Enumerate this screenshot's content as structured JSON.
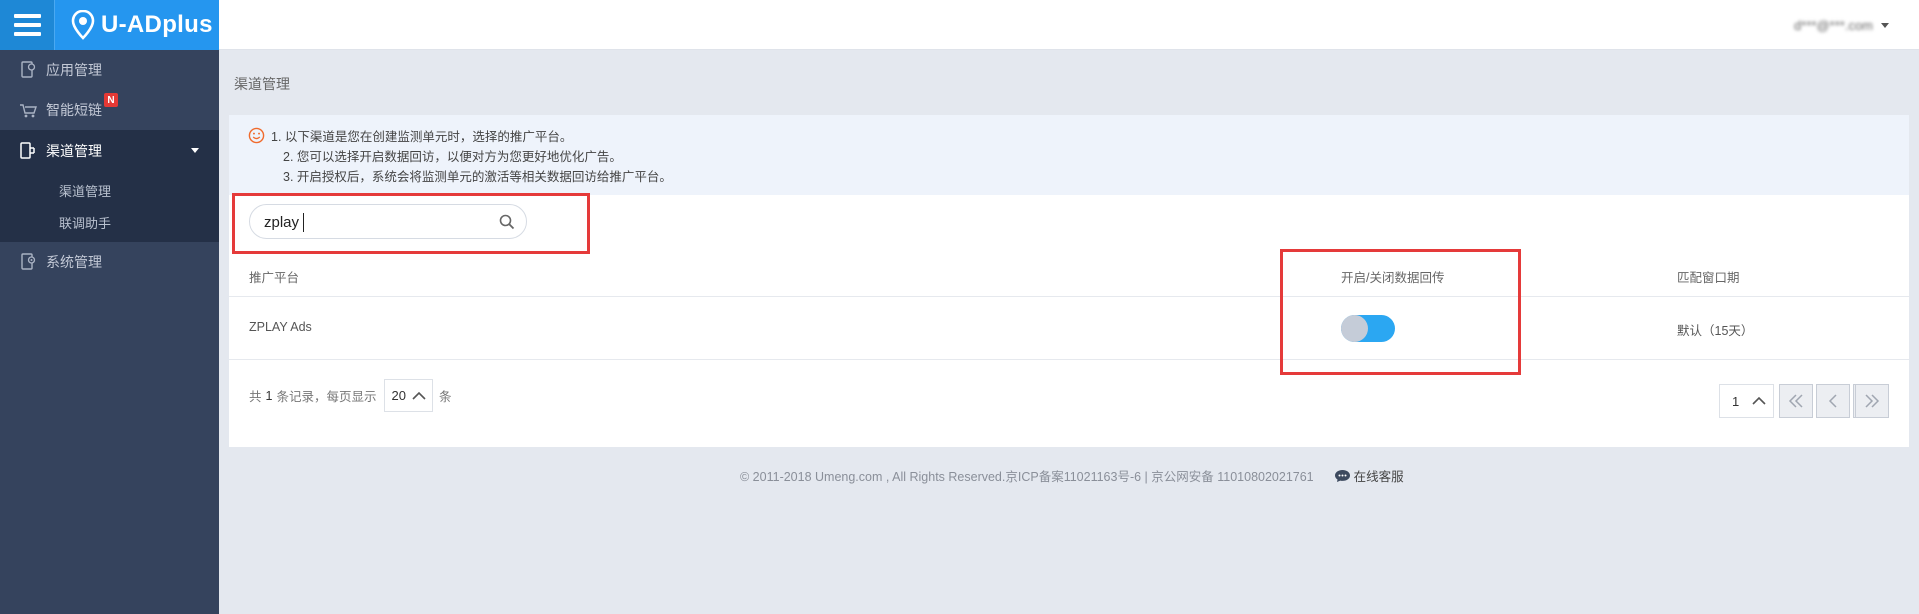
{
  "app": {
    "name": "U-ADplus"
  },
  "user": {
    "email": "d***@***.com"
  },
  "sidebar": {
    "items": [
      {
        "label": "应用管理",
        "icon": "app-manage-icon"
      },
      {
        "label": "智能短链",
        "icon": "smart-link-icon",
        "badge": "N"
      },
      {
        "label": "渠道管理",
        "icon": "channel-icon",
        "active": true,
        "children": [
          {
            "label": "渠道管理"
          },
          {
            "label": "联调助手"
          }
        ]
      },
      {
        "label": "系统管理",
        "icon": "system-icon"
      }
    ]
  },
  "breadcrumb": "渠道管理",
  "tips": [
    "1. 以下渠道是您在创建监测单元时，选择的推广平台。",
    "2. 您可以选择开启数据回访，以便对方为您更好地优化广告。",
    "3. 开启授权后，系统会将监测单元的激活等相关数据回访给推广平台。"
  ],
  "search": {
    "value": "zplay",
    "placeholder": ""
  },
  "table": {
    "columns": [
      "推广平台",
      "开启/关闭数据回传",
      "匹配窗口期"
    ],
    "rows": [
      {
        "platform": "ZPLAY Ads",
        "callback_enabled": true,
        "window": "默认（15天）"
      }
    ]
  },
  "pagination": {
    "total_prefix": "共",
    "total": "1",
    "total_suffix": "条记录，每页显示",
    "page_size": "20",
    "page_size_suffix": "条",
    "current_page": "1"
  },
  "footer": {
    "copyright": "© 2011-2018 Umeng.com , All Rights Reserved.京ICP备案11021163号-6 | 京公网安备 11010802021761",
    "service_label": "在线客服"
  },
  "colors": {
    "brand": "#2596ef",
    "sidebar": "#35435d",
    "highlight": "#e53a3a",
    "toggle_on": "#2ba7f2"
  }
}
